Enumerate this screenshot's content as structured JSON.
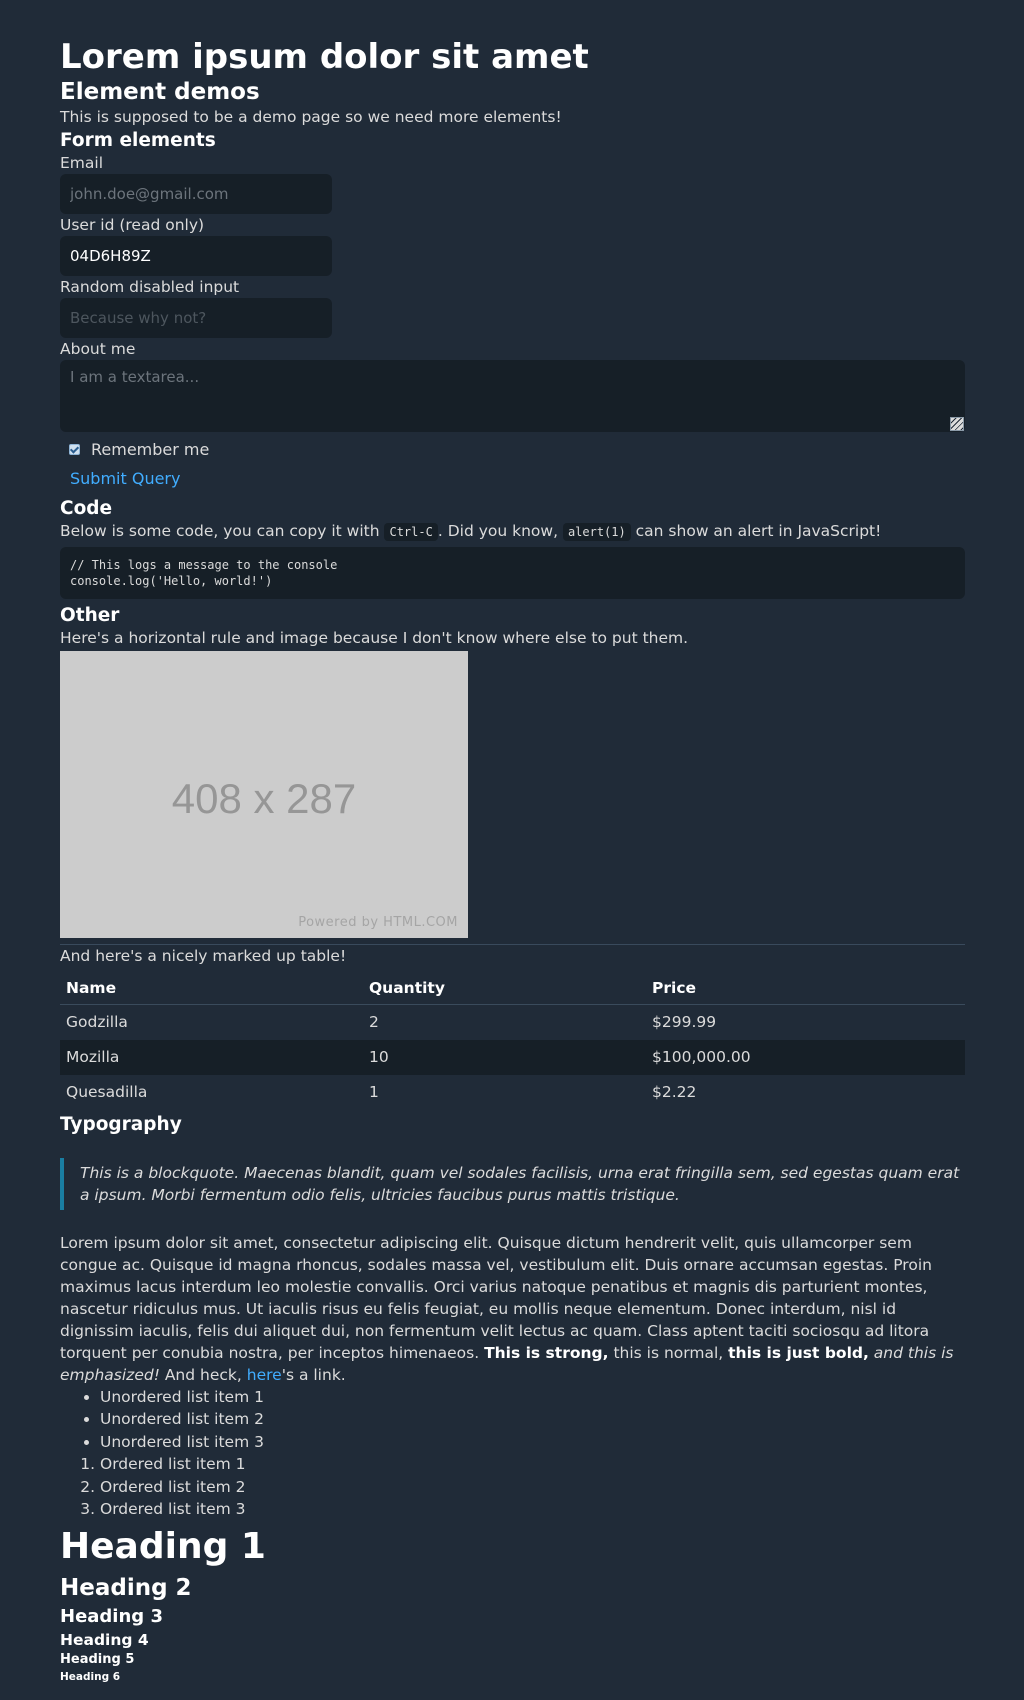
{
  "header": {
    "title": "Lorem ipsum dolor sit amet"
  },
  "demos": {
    "heading": "Element demos",
    "intro": "This is supposed to be a demo page so we need more elements!"
  },
  "form": {
    "heading": "Form elements",
    "email_label": "Email",
    "email_placeholder": "john.doe@gmail.com",
    "userid_label": "User id (read only)",
    "userid_value": "04D6H89Z",
    "disabled_label": "Random disabled input",
    "disabled_placeholder": "Because why not?",
    "about_label": "About me",
    "about_placeholder": "I am a textarea...",
    "remember_label": "Remember me",
    "remember_checked": true,
    "submit_label": "Submit Query"
  },
  "code": {
    "heading": "Code",
    "text_before": "Below is some code, you can copy it with ",
    "shortcut": "Ctrl-C",
    "text_middle": ". Did you know, ",
    "snippet": "alert(1)",
    "text_after": " can show an alert in JavaScript!",
    "block_line1": "// This logs a message to the console",
    "block_line2": "console.log('Hello, world!')"
  },
  "other": {
    "heading": "Other",
    "text": "Here's a horizontal rule and image because I don't know where else to put them.",
    "image_dims": "408 x 287",
    "image_credit": "Powered by HTML.COM",
    "table_intro": "And here's a nicely marked up table!"
  },
  "table": {
    "headers": [
      "Name",
      "Quantity",
      "Price"
    ],
    "rows": [
      [
        "Godzilla",
        "2",
        "$299.99"
      ],
      [
        "Mozilla",
        "10",
        "$100,000.00"
      ],
      [
        "Quesadilla",
        "1",
        "$2.22"
      ]
    ]
  },
  "typography": {
    "heading": "Typography",
    "blockquote": "This is a blockquote. Maecenas blandit, quam vel sodales facilisis, urna erat fringilla sem, sed egestas quam erat a ipsum. Morbi fermentum odio felis, ultricies faucibus purus mattis tristique.",
    "lorem": "Lorem ipsum dolor sit amet, consectetur adipiscing elit. Quisque dictum hendrerit velit, quis ullamcorper sem congue ac. Quisque id magna rhoncus, sodales massa vel, vestibulum elit. Duis ornare accumsan egestas. Proin maximus lacus interdum leo molestie convallis. Orci varius natoque penatibus et magnis dis parturient montes, nascetur ridiculus mus. Ut iaculis risus eu felis feugiat, eu mollis neque elementum. Donec interdum, nisl id dignissim iaculis, felis dui aliquet dui, non fermentum velit lectus ac quam. Class aptent taciti sociosqu ad litora torquent per conubia nostra, per inceptos himenaeos. ",
    "strong": "This is strong,",
    "normal": " this is normal, ",
    "bold": "this is just bold,",
    "emph": " and this is emphasized!",
    "and_heck": " And heck, ",
    "link_text": "here",
    "link_suffix": "'s a link.",
    "ul_items": [
      "Unordered list item 1",
      "Unordered list item 2",
      "Unordered list item 3"
    ],
    "ol_items": [
      "Ordered list item 1",
      "Ordered list item 2",
      "Ordered list item 3"
    ],
    "headings": [
      "Heading 1",
      "Heading 2",
      "Heading 3",
      "Heading 4",
      "Heading 5",
      "Heading 6"
    ]
  },
  "colors": {
    "background": "#202b38",
    "input_bg": "#161f27",
    "link": "#41adff",
    "blockquote_border": "#1a7ea2"
  }
}
